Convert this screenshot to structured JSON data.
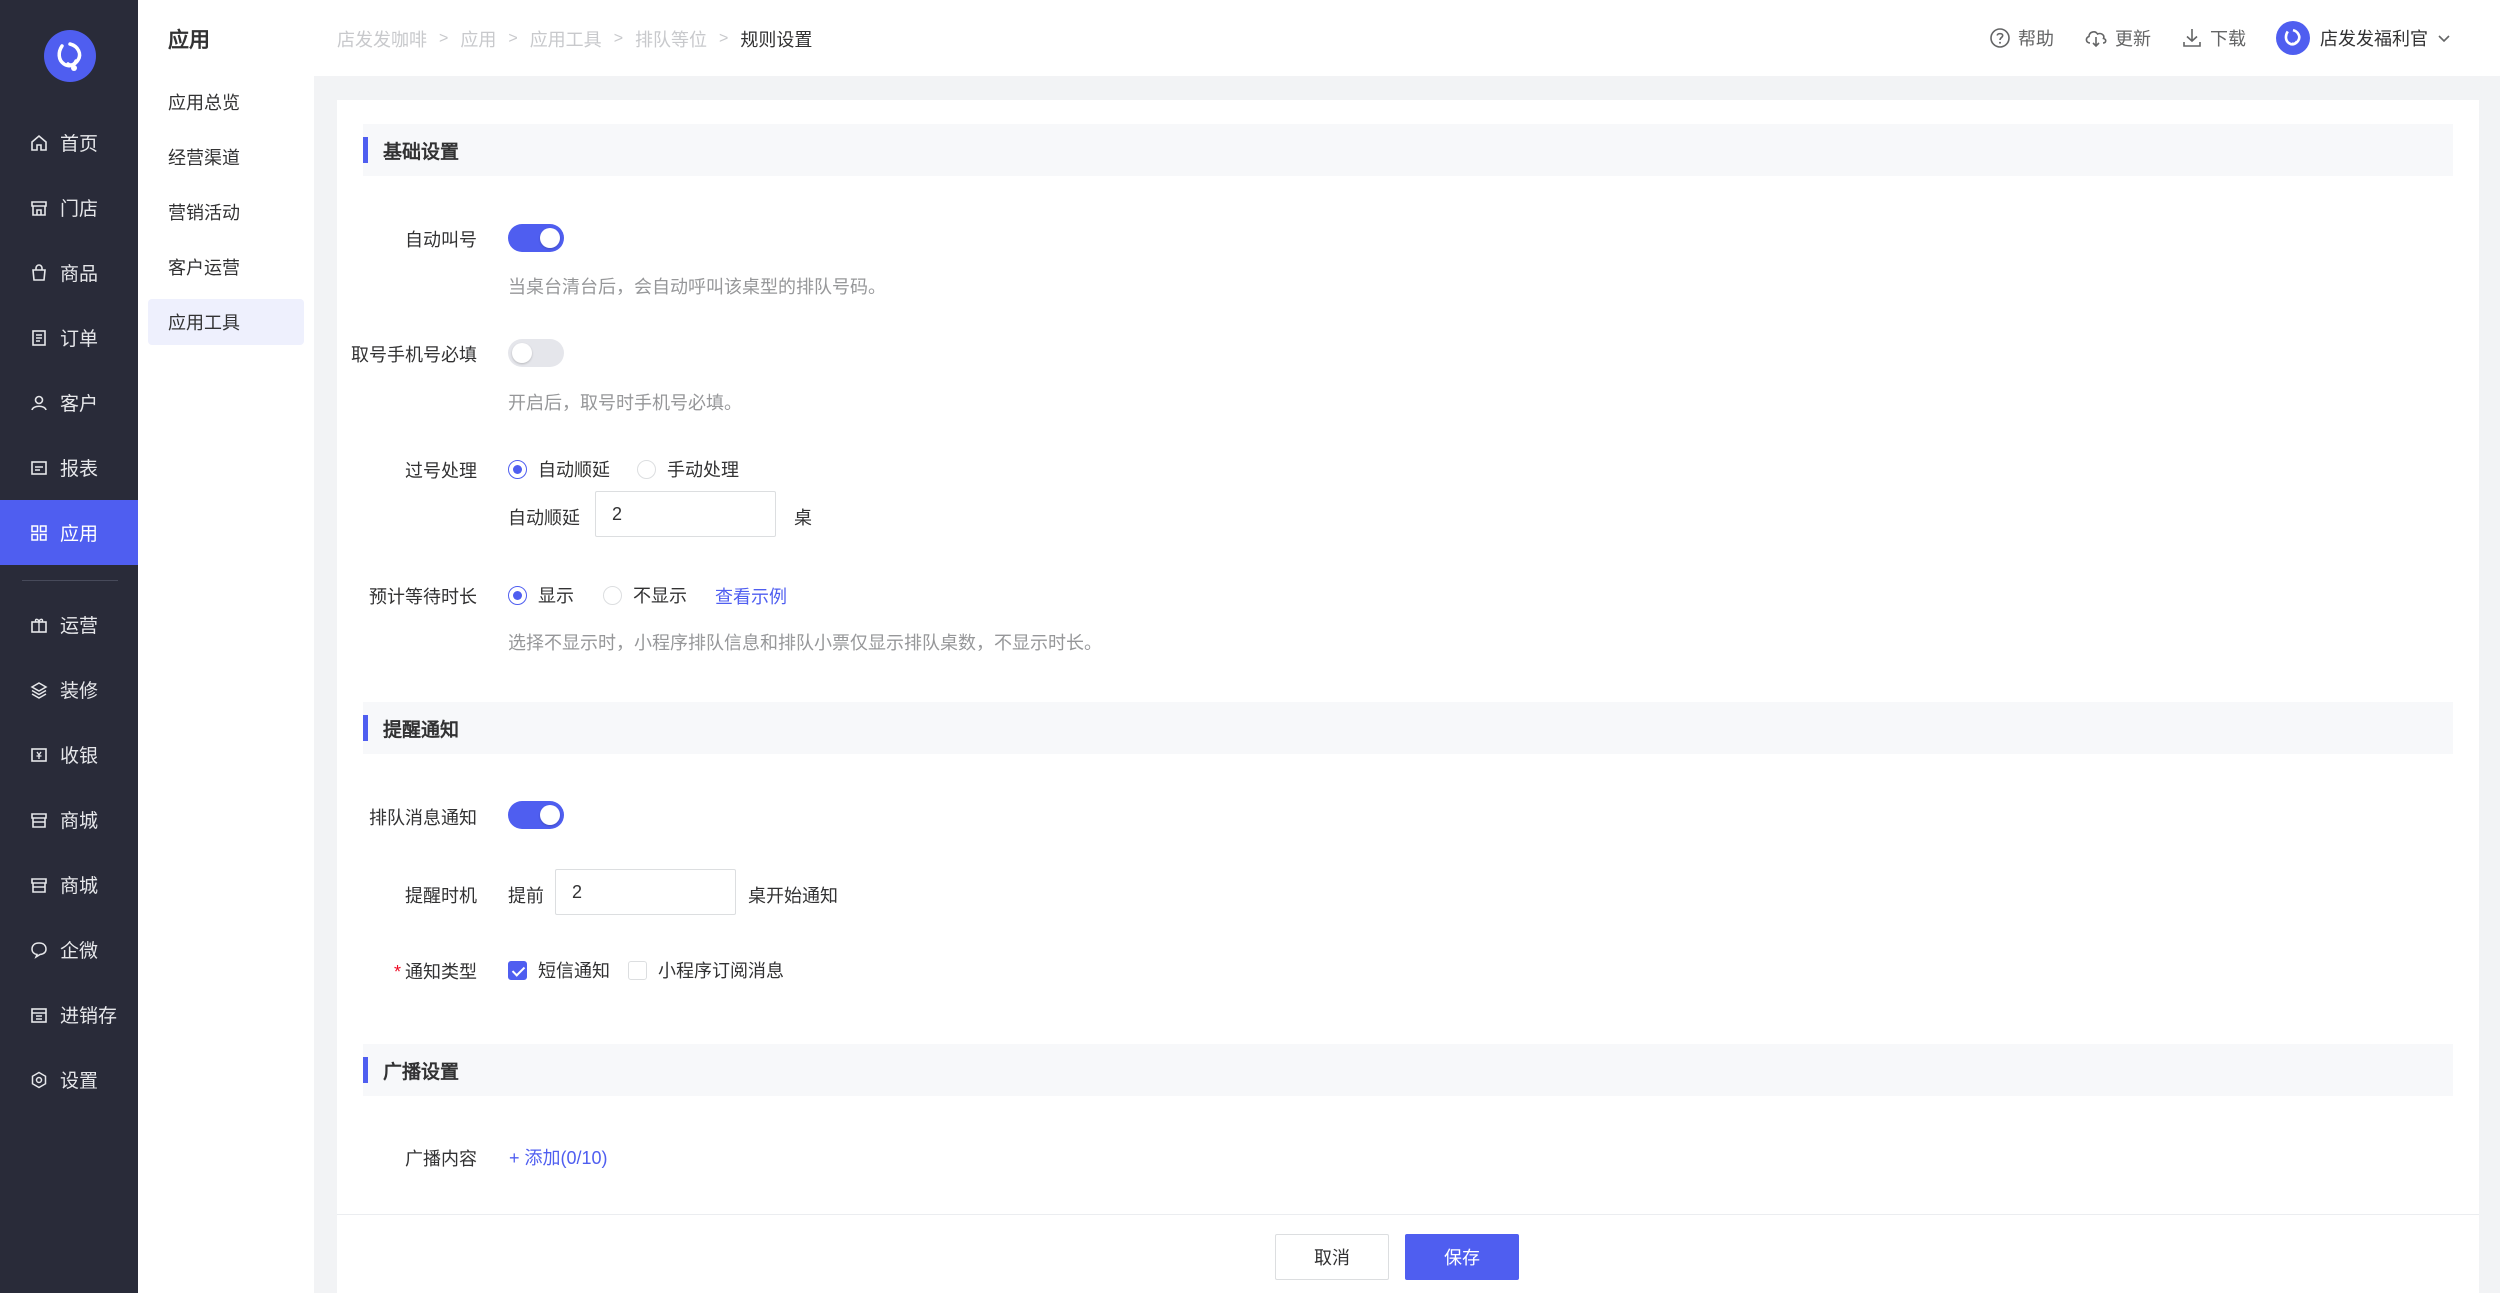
{
  "nav": {
    "items": [
      {
        "label": "首页",
        "icon": "home-icon"
      },
      {
        "label": "门店",
        "icon": "store-icon"
      },
      {
        "label": "商品",
        "icon": "bag-icon"
      },
      {
        "label": "订单",
        "icon": "order-icon"
      },
      {
        "label": "客户",
        "icon": "user-icon"
      },
      {
        "label": "报表",
        "icon": "report-icon"
      },
      {
        "label": "应用",
        "icon": "apps-icon",
        "active": true
      },
      {
        "label": "运营",
        "icon": "gift-icon"
      },
      {
        "label": "装修",
        "icon": "layers-icon"
      },
      {
        "label": "收银",
        "icon": "cashier-icon"
      },
      {
        "label": "商城",
        "icon": "shop-icon"
      },
      {
        "label": "商城",
        "icon": "shop-icon"
      },
      {
        "label": "企微",
        "icon": "chat-icon"
      },
      {
        "label": "进销存",
        "icon": "inventory-icon"
      },
      {
        "label": "设置",
        "icon": "gear-icon"
      }
    ]
  },
  "subnav": {
    "title": "应用",
    "items": [
      {
        "label": "应用总览"
      },
      {
        "label": "经营渠道"
      },
      {
        "label": "营销活动"
      },
      {
        "label": "客户运营"
      },
      {
        "label": "应用工具",
        "active": true
      }
    ]
  },
  "header": {
    "breadcrumb": [
      "店发发咖啡",
      "应用",
      "应用工具",
      "排队等位",
      "规则设置"
    ],
    "help": "帮助",
    "update": "更新",
    "download": "下载",
    "user": "店发发福利官"
  },
  "sections": {
    "basic": "基础设置",
    "notify": "提醒通知",
    "broadcast": "广播设置"
  },
  "form": {
    "auto_call": {
      "label": "自动叫号",
      "on": true,
      "help": "当桌台清台后，会自动呼叫该桌型的排队号码。"
    },
    "phone_required": {
      "label": "取号手机号必填",
      "on": false,
      "help": "开启后，取号时手机号必填。"
    },
    "skip": {
      "label": "过号处理",
      "options": [
        "自动顺延",
        "手动处理"
      ],
      "selected": "自动顺延",
      "delay_label": "自动顺延",
      "delay_value": "2",
      "delay_unit": "桌"
    },
    "wait_time": {
      "label": "预计等待时长",
      "options": [
        "显示",
        "不显示"
      ],
      "selected": "显示",
      "example_link": "查看示例",
      "help": "选择不显示时，小程序排队信息和排队小票仅显示排队桌数，不显示时长。"
    },
    "queue_notify": {
      "label": "排队消息通知",
      "on": true
    },
    "remind_timing": {
      "label": "提醒时机",
      "prefix": "提前",
      "value": "2",
      "suffix": "桌开始通知"
    },
    "notify_type": {
      "label": "通知类型",
      "required_mark": "*",
      "options": [
        {
          "label": "短信通知",
          "checked": true
        },
        {
          "label": "小程序订阅消息",
          "checked": false
        }
      ]
    },
    "broadcast_content": {
      "label": "广播内容",
      "add_link": "+ 添加(0/10)"
    }
  },
  "footer": {
    "cancel": "取消",
    "save": "保存"
  },
  "colors": {
    "accent": "#4f5ef0",
    "nav_bg": "#292b39"
  }
}
